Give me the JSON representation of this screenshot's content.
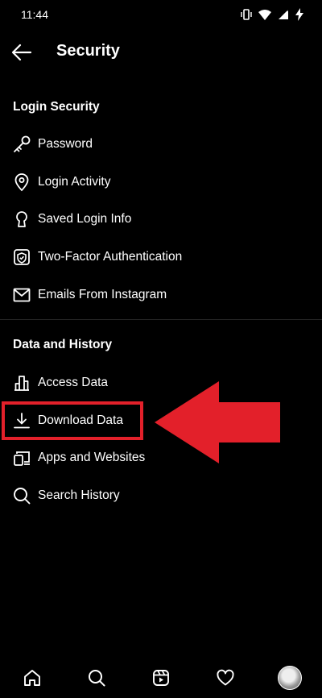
{
  "status_bar": {
    "time": "11:44",
    "icons": [
      "vibrate-icon",
      "wifi-icon",
      "signal-icon",
      "battery-charging-icon"
    ]
  },
  "header": {
    "title": "Security",
    "back_icon": "back-arrow-icon"
  },
  "sections": {
    "login_security": {
      "title": "Login Security",
      "items": [
        {
          "label": "Password",
          "icon": "key-icon"
        },
        {
          "label": "Login Activity",
          "icon": "location-pin-icon"
        },
        {
          "label": "Saved Login Info",
          "icon": "keyhole-icon"
        },
        {
          "label": "Two-Factor Authentication",
          "icon": "shield-check-icon"
        },
        {
          "label": "Emails From Instagram",
          "icon": "envelope-icon"
        }
      ]
    },
    "data_history": {
      "title": "Data and History",
      "items": [
        {
          "label": "Access Data",
          "icon": "bar-chart-icon"
        },
        {
          "label": "Download Data",
          "icon": "download-icon"
        },
        {
          "label": "Apps and Websites",
          "icon": "devices-icon"
        },
        {
          "label": "Search History",
          "icon": "search-icon"
        }
      ]
    }
  },
  "annotation": {
    "highlight_color": "#e3202a",
    "target": "Download Data"
  },
  "bottom_nav": {
    "items": [
      "home-icon",
      "search-icon",
      "reels-icon",
      "heart-icon",
      "profile-avatar"
    ]
  }
}
